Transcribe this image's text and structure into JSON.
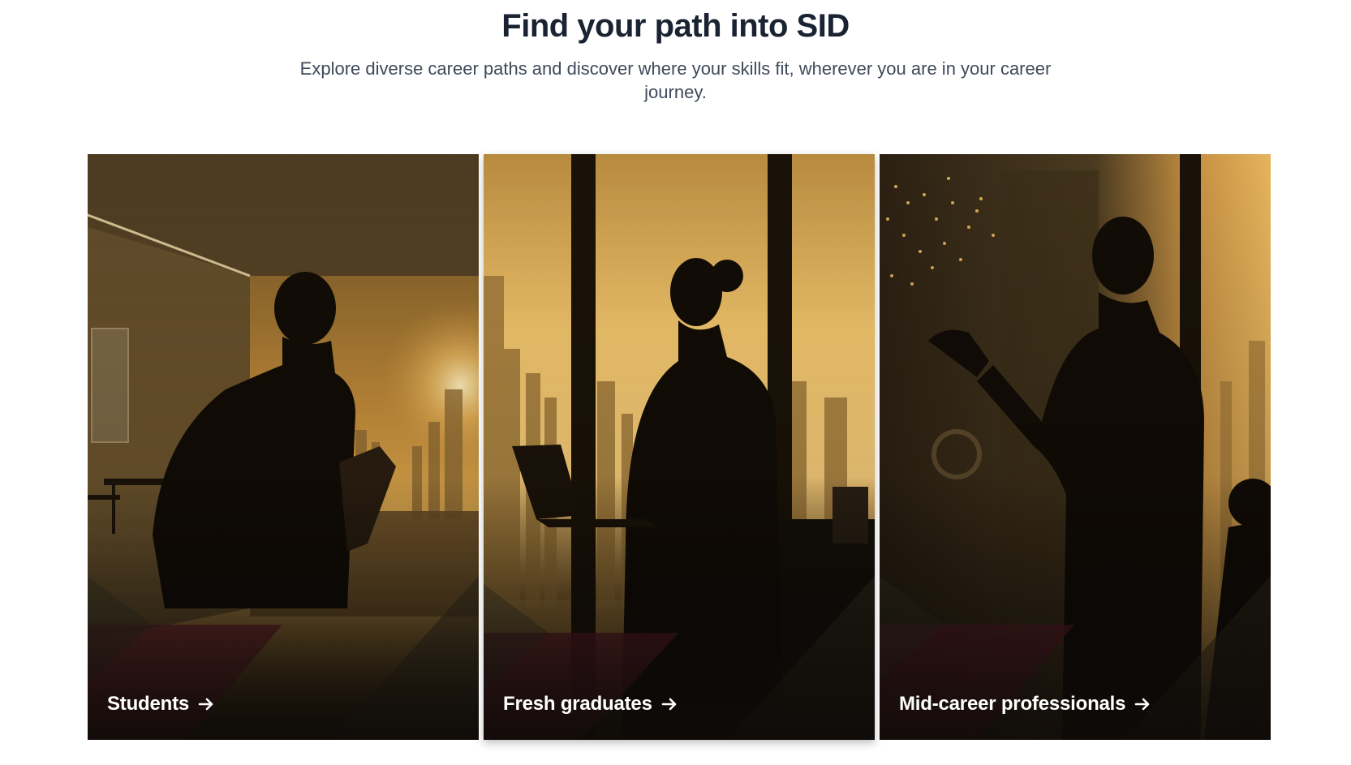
{
  "section": {
    "title": "Find your path into SID",
    "subtitle": "Explore diverse career paths and discover where your skills fit, wherever you are in your career journey."
  },
  "cards": [
    {
      "label": "Students",
      "icon": "arrow-right-icon"
    },
    {
      "label": "Fresh graduates",
      "icon": "arrow-right-icon"
    },
    {
      "label": "Mid-career professionals",
      "icon": "arrow-right-icon"
    }
  ],
  "colors": {
    "heading": "#1a2332",
    "subtitle": "#3f4a5a",
    "accent_maroon": "#6b1f2e",
    "sunset_gold": "#e8b04a"
  }
}
